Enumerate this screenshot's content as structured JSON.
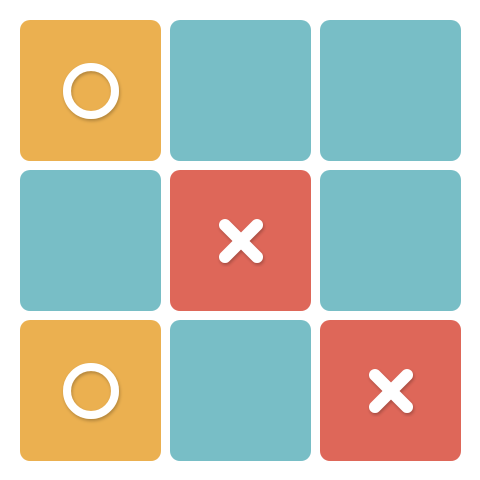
{
  "colors": {
    "empty": "#78bec6",
    "o": "#ebb050",
    "x": "#de6759",
    "mark": "#ffffff"
  },
  "board": {
    "cells": [
      {
        "row": 1,
        "col": 1,
        "mark": "O"
      },
      {
        "row": 1,
        "col": 2,
        "mark": ""
      },
      {
        "row": 1,
        "col": 3,
        "mark": ""
      },
      {
        "row": 2,
        "col": 1,
        "mark": ""
      },
      {
        "row": 2,
        "col": 2,
        "mark": "X"
      },
      {
        "row": 2,
        "col": 3,
        "mark": ""
      },
      {
        "row": 3,
        "col": 1,
        "mark": "O"
      },
      {
        "row": 3,
        "col": 2,
        "mark": ""
      },
      {
        "row": 3,
        "col": 3,
        "mark": "X"
      }
    ]
  }
}
